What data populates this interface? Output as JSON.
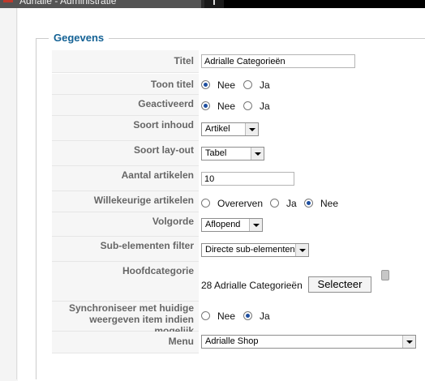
{
  "window": {
    "tab_title": "Adrialle - Administratie"
  },
  "fieldset": {
    "legend": "Gegevens"
  },
  "form": {
    "titel": {
      "label": "Titel",
      "value": "Adrialle Categorieën"
    },
    "toon_titel": {
      "label": "Toon titel",
      "options": [
        "Nee",
        "Ja"
      ],
      "selected": "Nee"
    },
    "geactiveerd": {
      "label": "Geactiveerd",
      "options": [
        "Nee",
        "Ja"
      ],
      "selected": "Nee"
    },
    "soort_inhoud": {
      "label": "Soort inhoud",
      "value": "Artikel"
    },
    "soort_layout": {
      "label": "Soort lay-out",
      "value": "Tabel"
    },
    "aantal_artikelen": {
      "label": "Aantal artikelen",
      "value": "10"
    },
    "willekeurige_artikelen": {
      "label": "Willekeurige artikelen",
      "options": [
        "Overerven",
        "Ja",
        "Nee"
      ],
      "selected": "Nee"
    },
    "volgorde": {
      "label": "Volgorde",
      "value": "Aflopend"
    },
    "sub_elementen_filter": {
      "label": "Sub-elementen filter",
      "value": "Directe sub-elementen"
    },
    "hoofdcategorie": {
      "label": "Hoofdcategorie",
      "value": "28 Adrialle Categorieën",
      "button": "Selecteer"
    },
    "synchroniseer": {
      "label_line1": "Synchroniseer met huidige",
      "label_line2": "weergeven item indien mogelijk",
      "options": [
        "Nee",
        "Ja"
      ],
      "selected": "Ja"
    },
    "menu": {
      "label": "Menu",
      "value": "Adrialle Shop"
    }
  },
  "icons": {
    "tab": "app-icon",
    "trash": "trash-icon"
  },
  "colors": {
    "legend": "#146295",
    "label": "#666666",
    "radio_selected": "#1e4fa0"
  }
}
